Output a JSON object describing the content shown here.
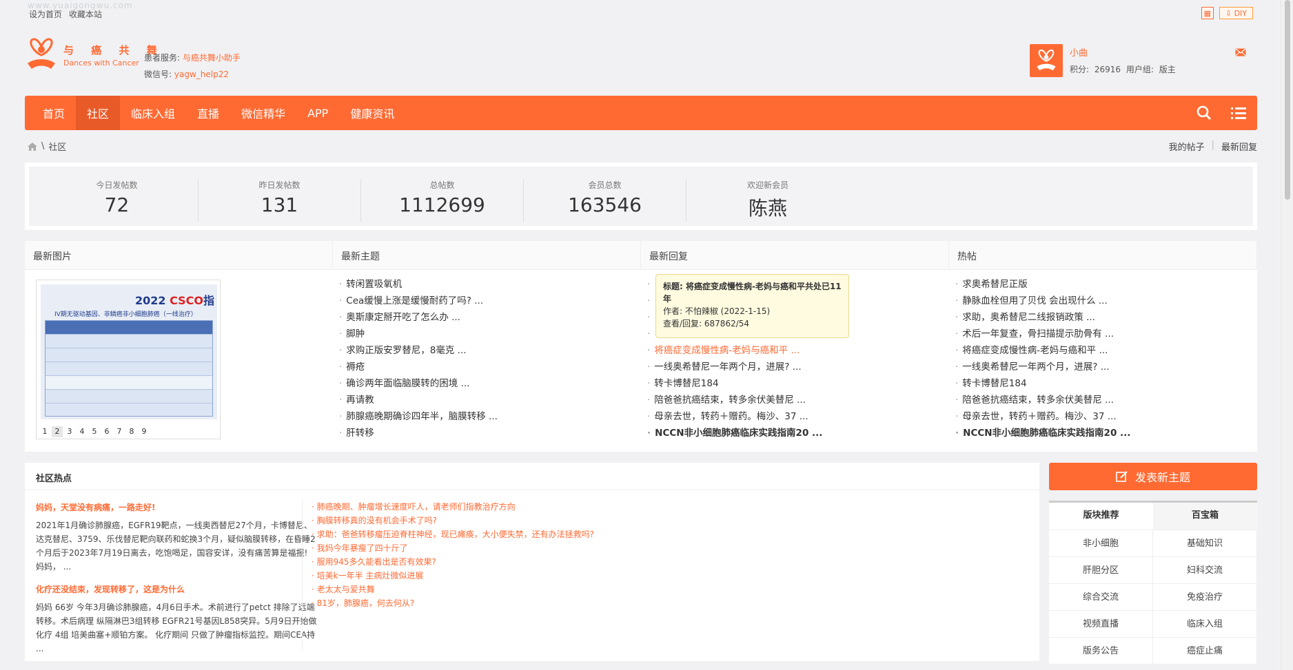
{
  "topbar": {
    "links": [
      "设为首页",
      "收藏本站"
    ],
    "watermark": "www.yuaigongwu.com",
    "diy_label": "DIY"
  },
  "header": {
    "logo_cn": "与 癌 共 舞",
    "logo_en": "Dances with Cancer",
    "service_label": "患者服务:",
    "service_link": "与癌共舞小助手",
    "wechat_label": "微信号:",
    "wechat_id": "yagw_help22"
  },
  "user": {
    "name": "小曲",
    "points": "积分: 26916",
    "group": "用户组: 版主"
  },
  "nav": {
    "items": [
      {
        "label": "首页",
        "active": false
      },
      {
        "label": "社区",
        "active": true
      },
      {
        "label": "临床入组",
        "active": false
      },
      {
        "label": "直播",
        "active": false
      },
      {
        "label": "微信精华",
        "active": false
      },
      {
        "label": "APP",
        "active": false
      },
      {
        "label": "健康资讯",
        "active": false
      }
    ]
  },
  "breadcrumb": {
    "current": "社区",
    "right": [
      "我的帖子",
      "最新回复"
    ]
  },
  "stats": [
    {
      "label": "今日发帖数",
      "value": "72"
    },
    {
      "label": "昨日发帖数",
      "value": "131"
    },
    {
      "label": "总帖数",
      "value": "1112699"
    },
    {
      "label": "会员总数",
      "value": "163546"
    },
    {
      "label": "欢迎新会员",
      "value": "陈燕"
    }
  ],
  "feed": {
    "headers": [
      "最新图片",
      "最新主题",
      "最新回复",
      "热帖"
    ],
    "image": {
      "title_year": "2022",
      "title_brand": "CSCO",
      "title_tail": "指",
      "subtitle": "IV期无驱动基因、非鳞癌非小细胞肺癌（一线治疗）",
      "pages": [
        "1",
        "2",
        "3",
        "4",
        "5",
        "6",
        "7",
        "8",
        "9"
      ]
    },
    "latest_topics": [
      "转闲置吸氧机",
      "Cea缓慢上涨是缓慢耐药了吗? ...",
      "奥斯康定掰开吃了怎么办 ...",
      "脚肿",
      "求购正版安罗替尼，8毫克 ...",
      "褥疮",
      "确诊两年面临脑膜转的困境 ...",
      "再请教",
      "肺腺癌晚期确诊四年半，脑膜转移 ...",
      "肝转移"
    ],
    "latest_replies": [
      "",
      "",
      "",
      "",
      "将癌症变成慢性病-老妈与癌和平 ...",
      "一线奥希替尼一年两个月，进展? ...",
      "转卡博替尼184",
      "陪爸爸抗癌结束，转多余伏美替尼 ...",
      "母亲去世，转药＋赠药。梅沙、37 ...",
      "NCCN非小细胞肺癌临床实践指南20 ..."
    ],
    "hot_posts": [
      "求奥希替尼正版",
      "静脉血栓但用了贝伐 会出现什么 ...",
      "求助，奥希替尼二线报销政策 ...",
      "术后一年复查，骨扫描提示肋骨有 ...",
      "将癌症变成慢性病-老妈与癌和平 ...",
      "一线奥希替尼一年两个月，进展? ...",
      "转卡博替尼184",
      "陪爸爸抗癌结束，转多余伏美替尼 ...",
      "母亲去世，转药＋赠药。梅沙、37 ...",
      "NCCN非小细胞肺癌临床实践指南20 ..."
    ],
    "tooltip": {
      "title": "标题: 将癌症变成慢性病-老妈与癌和平共处已11年",
      "author": "作者: 不怕辣椒 (2022-1-15)",
      "views": "查看/回复: 687862/54"
    }
  },
  "hot": {
    "heading": "社区热点",
    "articles": [
      {
        "title": "妈妈，天堂没有病痛，一路走好!",
        "excerpt": "2021年1月确诊肺腺癌，EGFR19靶点，一线奥西替尼27个月，卡博替尼、达克替尼、3759、乐伐替尼靶向联药和蛇换3个月，疑似脑膜转移，在昏睡2个月后于2023年7月19日离去，吃饱喝足，国容安详，没有痛苦算是福报! 妈妈，  ..."
      },
      {
        "title": "化疗还没结束，发现转移了，这是为什么",
        "excerpt": "妈妈 66岁 今年3月确诊肺腺癌，4月6日手术。术前进行了petct 排除了远端转移。术后病理 纵隔淋巴3组转移 EGFR21号基因L858突异。5月9日开始做化疗 4组 培美曲塞+顺铂方案。 化疗期间 只做了肿瘤指标监控。期间CEA持 ..."
      }
    ],
    "links": [
      "肺癌晚期、肿瘤增长速度吓人，请老师们指教治疗方向",
      "胸膜转移真的没有机会手术了吗?",
      "求助：爸爸转移瘤压迫脊柱神经，现已瘫痪，大小便失禁，还有办法拯救吗?",
      "我妈今年暴瘦了四十斤了",
      "服用945多久能看出是否有效果?",
      "培美k一年半 主病灶微似进展",
      "老太太与爱共舞",
      "81岁，肺腺癌，何去何从?"
    ]
  },
  "sidebar": {
    "post_button": "发表新主题",
    "tabs": [
      {
        "label": "版块推荐",
        "active": true
      },
      {
        "label": "百宝箱",
        "active": false
      }
    ],
    "grid": [
      "非小细胞",
      "基础知识",
      "肝胆分区",
      "妇科交流",
      "综合交流",
      "免疫治疗",
      "视频直播",
      "临床入组",
      "版务公告",
      "癌症止痛"
    ]
  },
  "colors": {
    "accent": "#ff6a33",
    "accent_dark": "#e85a28"
  }
}
